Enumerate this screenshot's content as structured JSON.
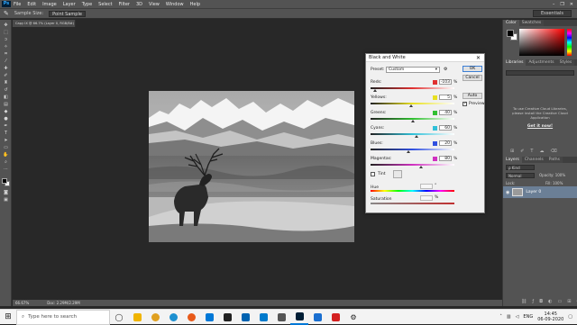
{
  "app": {
    "logo": "Ps"
  },
  "menu": [
    "File",
    "Edit",
    "Image",
    "Layer",
    "Type",
    "Select",
    "Filter",
    "3D",
    "View",
    "Window",
    "Help"
  ],
  "window_controls": [
    "–",
    "❐",
    "✕"
  ],
  "options_bar": {
    "sample_size_label": "Sample Size:",
    "sample_size_value": "Point Sample",
    "workspace": "Essentials"
  },
  "document": {
    "tab": "Capy IX @ 66.7% (Layer 0, RGB/8#) *",
    "status_zoom": "66.67%",
    "status_doc": "Doc: 2.29M/2.29M"
  },
  "dialog": {
    "title": "Black and White",
    "preset_label": "Preset:",
    "preset_value": "Custom",
    "ok": "OK",
    "cancel": "Cancel",
    "auto": "Auto",
    "preview_label": "Preview",
    "preview_checked": true,
    "channels": [
      {
        "label": "Reds:",
        "value": "-103",
        "percent": "%",
        "color": "#e03030",
        "level": 0.05
      },
      {
        "label": "Yellows:",
        "value": "5",
        "percent": "%",
        "color": "#e8e020",
        "level": 0.48
      },
      {
        "label": "Greens:",
        "value": "40",
        "percent": "%",
        "color": "#30c030",
        "level": 0.5
      },
      {
        "label": "Cyans:",
        "value": "60",
        "percent": "%",
        "color": "#30c0d8",
        "level": 0.55
      },
      {
        "label": "Blues:",
        "value": "20",
        "percent": "%",
        "color": "#3050e0",
        "level": 0.45
      },
      {
        "label": "Magentas:",
        "value": "80",
        "percent": "%",
        "color": "#d030c0",
        "level": 0.6
      }
    ],
    "tint_label": "Tint",
    "tint_checked": false,
    "hue_label": "Hue",
    "hue_unit": "°",
    "saturation_label": "Saturation",
    "saturation_unit": "%"
  },
  "right_dock": {
    "color_tabs": [
      "Color",
      "Swatches"
    ],
    "library_tabs": [
      "Libraries",
      "Adjustments",
      "Styles"
    ],
    "library_message": "To use Creative Cloud Libraries, please install the Creative Cloud Application",
    "library_link": "Get it now!",
    "layers_tabs": [
      "Layers",
      "Channels",
      "Paths"
    ],
    "layers_kind": "ρ Kind",
    "layers_blend": "Normal",
    "layers_opacity": "Opacity: 100%",
    "layers_fill": "Fill: 100%",
    "layers_lock": "Lock:",
    "layer_name": "Layer 0"
  },
  "taskbar": {
    "search_placeholder": "Type here to search",
    "time": "14:45",
    "date": "06-09-2020",
    "lang": "ENG"
  },
  "colors": {
    "ps_panel": "#535353",
    "canvas_bg": "#282828",
    "fg_swatch": "#000000",
    "bg_swatch": "#ffffff",
    "color_field_hue": "#ff0000"
  }
}
